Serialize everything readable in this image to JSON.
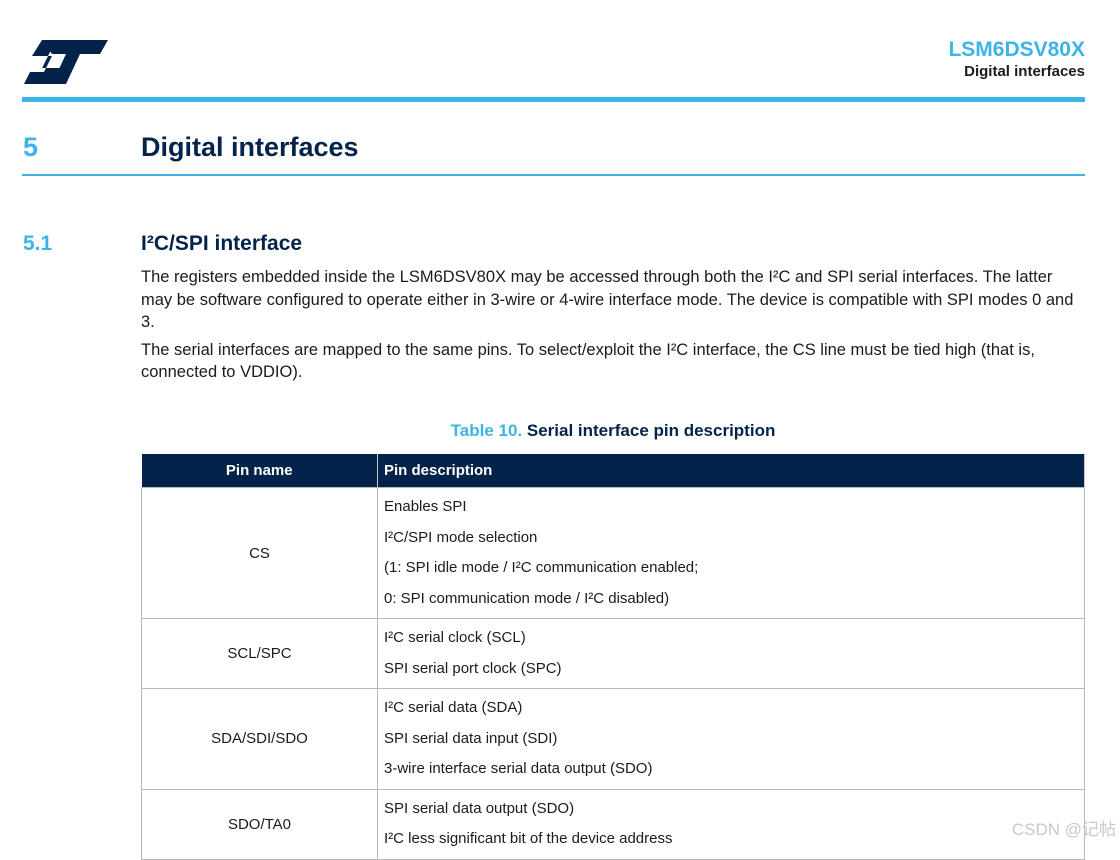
{
  "header": {
    "product": "LSM6DSV80X",
    "section": "Digital interfaces",
    "logo_icon": "st-logo-icon",
    "brand_color": "#03234b",
    "accent_color": "#3cb4e6"
  },
  "section": {
    "number": "5",
    "title": "Digital interfaces"
  },
  "subsection": {
    "number": "5.1",
    "title": "I²C/SPI interface"
  },
  "paragraphs": [
    "The registers embedded inside the LSM6DSV80X may be accessed through both the I²C and SPI serial interfaces. The latter may be software configured to operate either in 3-wire or 4-wire interface mode. The device is compatible with SPI modes 0 and 3.",
    "The serial interfaces are mapped to the same pins. To select/exploit the I²C interface, the CS line must be tied high (that is, connected to VDDIO)."
  ],
  "table": {
    "caption_label": "Table 10.",
    "caption_title": "Serial interface pin description",
    "headers": [
      "Pin name",
      "Pin description"
    ],
    "rows": [
      {
        "pin": "CS",
        "desc": [
          "Enables SPI",
          "I²C/SPI mode selection",
          "(1: SPI idle mode / I²C communication enabled;",
          "0: SPI communication mode / I²C disabled)"
        ]
      },
      {
        "pin": "SCL/SPC",
        "desc": [
          "I²C serial clock (SCL)",
          "SPI serial port clock (SPC)"
        ]
      },
      {
        "pin": "SDA/SDI/SDO",
        "desc": [
          "I²C serial data (SDA)",
          "SPI serial data input (SDI)",
          "3-wire interface serial data output (SDO)"
        ]
      },
      {
        "pin": "SDO/TA0",
        "desc": [
          "SPI serial data output (SDO)",
          "I²C less significant bit of the device address"
        ]
      }
    ]
  },
  "watermark": "CSDN @记帖"
}
